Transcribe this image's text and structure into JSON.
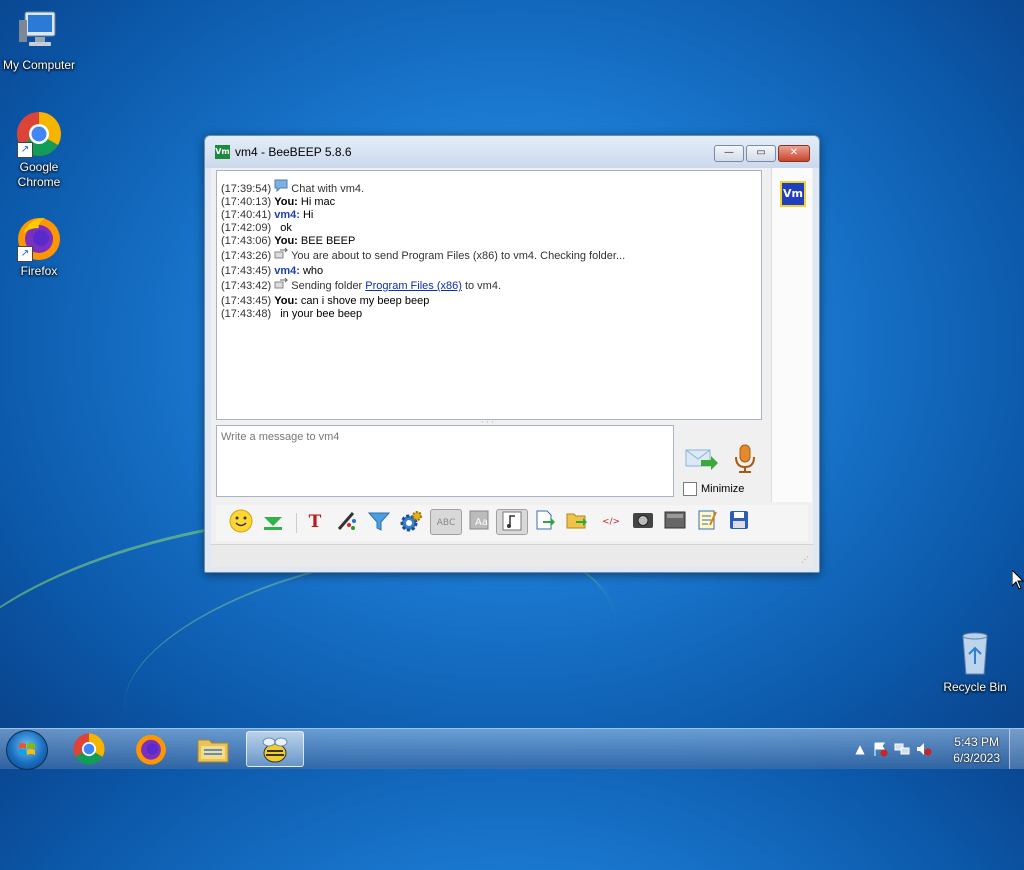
{
  "desktop": {
    "icons": [
      {
        "label": "My Computer"
      },
      {
        "label": "Google\nChrome"
      },
      {
        "label": "Firefox"
      },
      {
        "label": "Recycle Bin"
      }
    ]
  },
  "window": {
    "title": "vm4 - BeeBEEP 5.8.6",
    "app_icon_text": "Vm",
    "controls": {
      "minimize": "—",
      "maximize": "▭",
      "close": "✕"
    }
  },
  "chat": {
    "lines": [
      {
        "time": "(17:39:54)",
        "text": "Chat with vm4."
      },
      {
        "time": "(17:40:13)",
        "sender": "You:",
        "text": "Hi mac"
      },
      {
        "time": "(17:40:41)",
        "sender": "vm4:",
        "text": "Hi"
      },
      {
        "time": "(17:42:09)",
        "text": "ok"
      },
      {
        "time": "(17:43:06)",
        "sender": "You:",
        "text": "BEE BEEP"
      },
      {
        "time": "(17:43:26)",
        "text": "You are about to send Program Files (x86) to vm4. Checking folder..."
      },
      {
        "time": "(17:43:45)",
        "sender": "vm4:",
        "text": "who"
      },
      {
        "time": "(17:43:42)",
        "text_before": "Sending folder",
        "link": "Program Files (x86)",
        "text_after": "to vm4."
      },
      {
        "time": "(17:43:45)",
        "sender": "You:",
        "text": "can i shove my beep beep"
      },
      {
        "time": "(17:43:48)",
        "text": "in your bee beep"
      }
    ]
  },
  "composer": {
    "placeholder": "Write a message to vm4",
    "minimize_label": "Minimize"
  },
  "user_badge": "Vm",
  "toolbar": {
    "icons": [
      "emoticon-icon",
      "download-icon",
      "font-icon",
      "color-icon",
      "filter-icon",
      "settings-icon",
      "spellcheck-icon",
      "text-icon",
      "music-note-icon",
      "send-file-icon",
      "send-folder-icon",
      "html-icon",
      "screenshot-icon",
      "screen-icon",
      "notes-icon",
      "save-icon"
    ]
  },
  "taskbar": {
    "time": "5:43 PM",
    "date": "6/3/2023",
    "apps": [
      "chrome-icon",
      "firefox-icon",
      "explorer-icon",
      "beebeep-icon"
    ]
  }
}
